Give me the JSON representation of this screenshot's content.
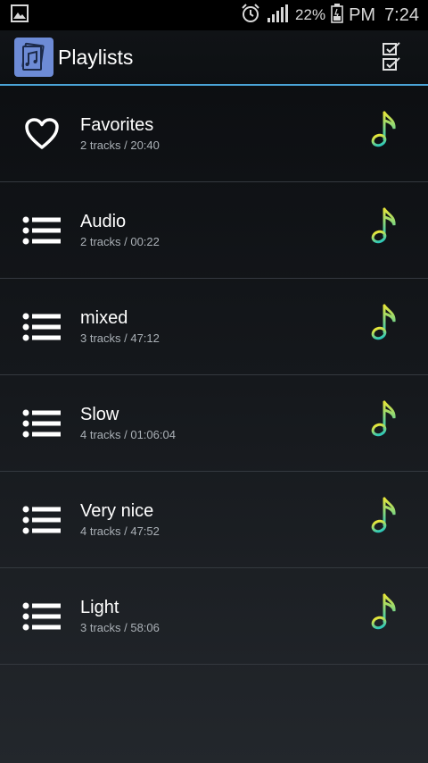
{
  "status_bar": {
    "battery": "22%",
    "ampm": "PM",
    "time": "7:24",
    "icons": [
      "gallery-icon",
      "alarm-icon",
      "signal-icon",
      "battery-icon"
    ]
  },
  "action_bar": {
    "title": "Playlists",
    "app_icon": "music-pages-icon",
    "action_icon": "select-all-checklist-icon",
    "accent_color": "#4aa3d6"
  },
  "playlists": [
    {
      "title": "Favorites",
      "subtitle": "2 tracks / 20:40",
      "icon": "heart-icon"
    },
    {
      "title": "Audio",
      "subtitle": "2 tracks / 00:22",
      "icon": "list-icon"
    },
    {
      "title": "mixed",
      "subtitle": "3 tracks / 47:12",
      "icon": "list-icon"
    },
    {
      "title": "Slow",
      "subtitle": "4 tracks / 01:06:04",
      "icon": "list-icon"
    },
    {
      "title": "Very nice",
      "subtitle": "4 tracks / 47:52",
      "icon": "list-icon"
    },
    {
      "title": "Light",
      "subtitle": "3 tracks / 58:06",
      "icon": "list-icon"
    }
  ],
  "colors": {
    "note_yellow": "#e6e63a",
    "note_teal": "#2ec8b8"
  }
}
